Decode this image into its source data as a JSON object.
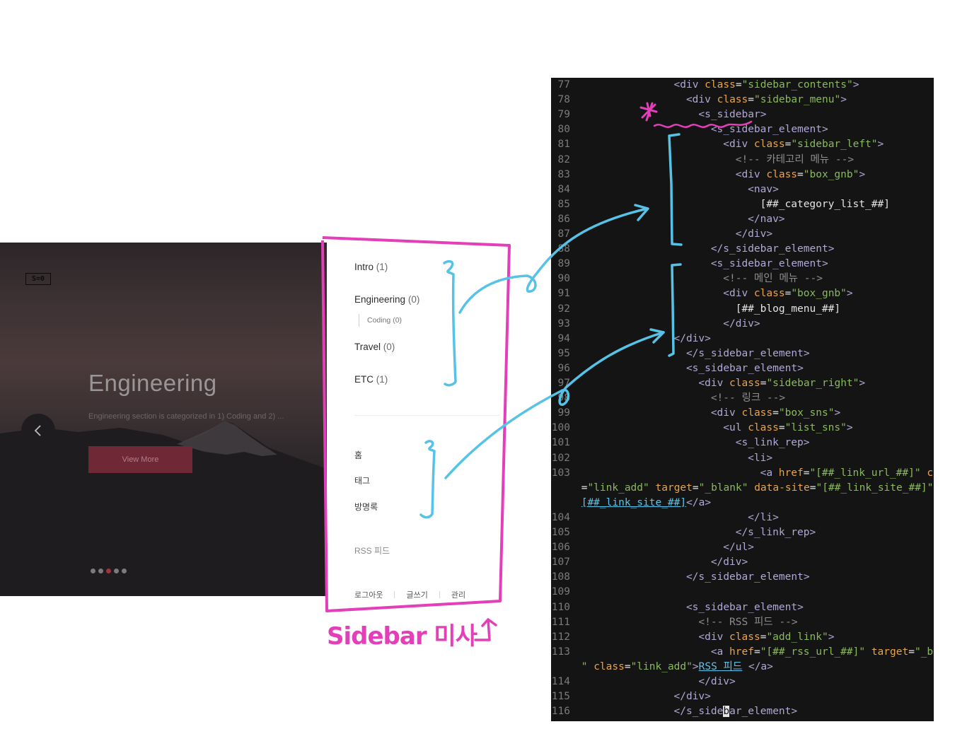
{
  "hero": {
    "logo": "S=0",
    "title": "Engineering",
    "description": "Engineering section is categorized in 1) Coding and 2) ...",
    "button_label": "View More",
    "dots": 5,
    "active_dot": 3
  },
  "sidebar": {
    "categories": [
      {
        "name": "Intro",
        "count": "(1)"
      },
      {
        "name": "Engineering",
        "count": "(0)"
      },
      {
        "name": "Travel",
        "count": "(0)"
      },
      {
        "name": "ETC",
        "count": "(1)"
      }
    ],
    "subcategory": "Coding (0)",
    "menu": [
      "홈",
      "태그",
      "방명록"
    ],
    "rss": "RSS 피드",
    "footer": [
      "로그아웃",
      "글쓰기",
      "관리"
    ]
  },
  "annotation": {
    "label": "Sidebar 미사",
    "arrow": "↑"
  },
  "colors": {
    "annotation_pink": "#e23fb8",
    "annotation_blue": "#56c2e6",
    "code_background": "#141414",
    "view_more_button": "#6e2836"
  },
  "code": {
    "lines": [
      {
        "n": "77",
        "indent": 8,
        "parts": [
          [
            "tag",
            "<div "
          ],
          [
            "attr",
            "class"
          ],
          [
            "text",
            "="
          ],
          [
            "str",
            "\"sidebar_contents\""
          ],
          [
            "tag",
            ">"
          ]
        ]
      },
      {
        "n": "78",
        "indent": 9,
        "parts": [
          [
            "tag",
            "<div "
          ],
          [
            "attr",
            "class"
          ],
          [
            "text",
            "="
          ],
          [
            "str",
            "\"sidebar_menu\""
          ],
          [
            "tag",
            ">"
          ]
        ]
      },
      {
        "n": "79",
        "indent": 10,
        "parts": [
          [
            "tag",
            "<s_sidebar>"
          ]
        ]
      },
      {
        "n": "80",
        "indent": 11,
        "parts": [
          [
            "tag",
            "<s_sidebar_element>"
          ]
        ]
      },
      {
        "n": "81",
        "indent": 12,
        "parts": [
          [
            "tag",
            "<div "
          ],
          [
            "attr",
            "class"
          ],
          [
            "text",
            "="
          ],
          [
            "str",
            "\"sidebar_left\""
          ],
          [
            "tag",
            ">"
          ]
        ]
      },
      {
        "n": "82",
        "indent": 13,
        "parts": [
          [
            "com",
            "<!-- 카테고리 메뉴 -->"
          ]
        ]
      },
      {
        "n": "83",
        "indent": 13,
        "parts": [
          [
            "tag",
            "<div "
          ],
          [
            "attr",
            "class"
          ],
          [
            "text",
            "="
          ],
          [
            "str",
            "\"box_gnb\""
          ],
          [
            "tag",
            ">"
          ]
        ]
      },
      {
        "n": "84",
        "indent": 14,
        "parts": [
          [
            "tag",
            "<nav>"
          ]
        ]
      },
      {
        "n": "85",
        "indent": 15,
        "parts": [
          [
            "text",
            "[##_category_list_##]"
          ]
        ]
      },
      {
        "n": "86",
        "indent": 14,
        "parts": [
          [
            "tag",
            "</nav>"
          ]
        ]
      },
      {
        "n": "87",
        "indent": 13,
        "parts": [
          [
            "tag",
            "</div>"
          ]
        ]
      },
      {
        "n": "88",
        "indent": 11,
        "parts": [
          [
            "tag",
            "</s_sidebar_element>"
          ]
        ]
      },
      {
        "n": "89",
        "indent": 11,
        "parts": [
          [
            "tag",
            "<s_sidebar_element>"
          ]
        ]
      },
      {
        "n": "90",
        "indent": 12,
        "parts": [
          [
            "com",
            "<!-- 메인 메뉴 -->"
          ]
        ]
      },
      {
        "n": "91",
        "indent": 12,
        "parts": [
          [
            "tag",
            "<div "
          ],
          [
            "attr",
            "class"
          ],
          [
            "text",
            "="
          ],
          [
            "str",
            "\"box_gnb\""
          ],
          [
            "tag",
            ">"
          ]
        ]
      },
      {
        "n": "92",
        "indent": 13,
        "parts": [
          [
            "text",
            "[##_blog_menu_##]"
          ]
        ]
      },
      {
        "n": "93",
        "indent": 12,
        "parts": [
          [
            "tag",
            "</div>"
          ]
        ]
      },
      {
        "n": "94",
        "indent": 8,
        "parts": [
          [
            "tag",
            "</div>"
          ]
        ]
      },
      {
        "n": "95",
        "indent": 9,
        "parts": [
          [
            "tag",
            "</s_sidebar_element>"
          ]
        ]
      },
      {
        "n": "96",
        "indent": 9,
        "parts": [
          [
            "tag",
            "<s_sidebar_element>"
          ]
        ]
      },
      {
        "n": "97",
        "indent": 10,
        "parts": [
          [
            "tag",
            "<div "
          ],
          [
            "attr",
            "class"
          ],
          [
            "text",
            "="
          ],
          [
            "str",
            "\"sidebar_right\""
          ],
          [
            "tag",
            ">"
          ]
        ]
      },
      {
        "n": "98",
        "indent": 11,
        "parts": [
          [
            "com",
            "<!-- 링크 -->"
          ]
        ]
      },
      {
        "n": "99",
        "indent": 11,
        "parts": [
          [
            "tag",
            "<div "
          ],
          [
            "attr",
            "class"
          ],
          [
            "text",
            "="
          ],
          [
            "str",
            "\"box_sns\""
          ],
          [
            "tag",
            ">"
          ]
        ]
      },
      {
        "n": "100",
        "indent": 12,
        "parts": [
          [
            "tag",
            "<ul "
          ],
          [
            "attr",
            "class"
          ],
          [
            "text",
            "="
          ],
          [
            "str",
            "\"list_sns\""
          ],
          [
            "tag",
            ">"
          ]
        ]
      },
      {
        "n": "101",
        "indent": 13,
        "parts": [
          [
            "tag",
            "<s_link_rep>"
          ]
        ]
      },
      {
        "n": "102",
        "indent": 14,
        "parts": [
          [
            "tag",
            "<li>"
          ]
        ]
      },
      {
        "n": "103",
        "indent": 15,
        "parts": [
          [
            "tag",
            "<a "
          ],
          [
            "attr",
            "href"
          ],
          [
            "text",
            "="
          ],
          [
            "str",
            "\"[##_link_url_##]\""
          ],
          [
            "text",
            " "
          ],
          [
            "attr",
            "class"
          ]
        ]
      },
      {
        "n": "",
        "indent": 1,
        "parts": [
          [
            "text",
            "="
          ],
          [
            "str",
            "\"link_add\""
          ],
          [
            "text",
            " "
          ],
          [
            "attr",
            "target"
          ],
          [
            "text",
            "="
          ],
          [
            "str",
            "\"_blank\""
          ],
          [
            "text",
            " "
          ],
          [
            "attr",
            "data-site"
          ],
          [
            "text",
            "="
          ],
          [
            "str",
            "\"[##_link_site_##]\""
          ],
          [
            "tag",
            ">"
          ]
        ]
      },
      {
        "n": "",
        "indent": 1,
        "parts": [
          [
            "link",
            "[##_link_site_##]"
          ],
          [
            "tag",
            "</a>"
          ]
        ]
      },
      {
        "n": "104",
        "indent": 14,
        "parts": [
          [
            "tag",
            "</li>"
          ]
        ]
      },
      {
        "n": "105",
        "indent": 13,
        "parts": [
          [
            "tag",
            "</s_link_rep>"
          ]
        ]
      },
      {
        "n": "106",
        "indent": 12,
        "parts": [
          [
            "tag",
            "</ul>"
          ]
        ]
      },
      {
        "n": "107",
        "indent": 11,
        "parts": [
          [
            "tag",
            "</div>"
          ]
        ]
      },
      {
        "n": "108",
        "indent": 9,
        "parts": [
          [
            "tag",
            "</s_sidebar_element>"
          ]
        ]
      },
      {
        "n": "109",
        "indent": 0,
        "parts": []
      },
      {
        "n": "110",
        "indent": 9,
        "parts": [
          [
            "tag",
            "<s_sidebar_element>"
          ]
        ]
      },
      {
        "n": "111",
        "indent": 10,
        "parts": [
          [
            "com",
            "<!-- RSS 피드 -->"
          ]
        ]
      },
      {
        "n": "112",
        "indent": 10,
        "parts": [
          [
            "tag",
            "<div "
          ],
          [
            "attr",
            "class"
          ],
          [
            "text",
            "="
          ],
          [
            "str",
            "\"add_link\""
          ],
          [
            "tag",
            ">"
          ]
        ]
      },
      {
        "n": "113",
        "indent": 11,
        "parts": [
          [
            "tag",
            "<a "
          ],
          [
            "attr",
            "href"
          ],
          [
            "text",
            "="
          ],
          [
            "str",
            "\"[##_rss_url_##]\""
          ],
          [
            "text",
            " "
          ],
          [
            "attr",
            "target"
          ],
          [
            "text",
            "="
          ],
          [
            "str",
            "\"_blank"
          ]
        ]
      },
      {
        "n": "",
        "indent": 1,
        "parts": [
          [
            "str",
            "\""
          ],
          [
            "text",
            " "
          ],
          [
            "attr",
            "class"
          ],
          [
            "text",
            "="
          ],
          [
            "str",
            "\"link_add\""
          ],
          [
            "tag",
            ">"
          ],
          [
            "link",
            "RSS 피드"
          ],
          [
            "tag",
            " </a>"
          ]
        ]
      },
      {
        "n": "114",
        "indent": 10,
        "parts": [
          [
            "tag",
            "</div>"
          ]
        ]
      },
      {
        "n": "115",
        "indent": 8,
        "parts": [
          [
            "tag",
            "</div>"
          ]
        ]
      },
      {
        "n": "116",
        "indent": 8,
        "parts": [
          [
            "tag",
            "</s_side"
          ],
          [
            "cursor",
            "b"
          ],
          [
            "tag",
            "ar_element>"
          ]
        ]
      }
    ]
  }
}
